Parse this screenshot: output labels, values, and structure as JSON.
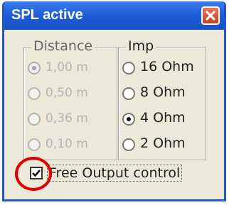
{
  "window": {
    "title": "SPL active"
  },
  "distance_group": {
    "title": "Distance",
    "options": [
      {
        "label": "1,00 m",
        "checked": true
      },
      {
        "label": "0,50 m",
        "checked": false
      },
      {
        "label": "0,36 m",
        "checked": false
      },
      {
        "label": "0,10 m",
        "checked": false
      }
    ],
    "enabled": false
  },
  "imp_group": {
    "title": "Imp",
    "options": [
      {
        "label": "16 Ohm",
        "checked": false
      },
      {
        "label": "8 Ohm",
        "checked": false
      },
      {
        "label": "4 Ohm",
        "checked": true
      },
      {
        "label": "2 Ohm",
        "checked": false
      }
    ],
    "enabled": true
  },
  "checkbox": {
    "label": "Free Output control",
    "checked": true
  },
  "annotation": {
    "color": "#e00000"
  },
  "colors": {
    "titlebar": "#1f5fd8",
    "dialog_bg": "#ece9d8",
    "close_button": "#c1421f"
  }
}
